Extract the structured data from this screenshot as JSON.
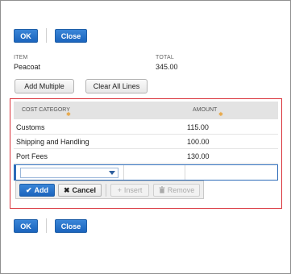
{
  "top_buttons": {
    "ok": "OK",
    "close": "Close"
  },
  "bottom_buttons": {
    "ok": "OK",
    "close": "Close"
  },
  "item": {
    "label": "ITEM",
    "value": "Peacoat"
  },
  "total": {
    "label": "TOTAL",
    "value": "345.00"
  },
  "toolbar": {
    "add_multiple": "Add Multiple",
    "clear_all_lines": "Clear All Lines"
  },
  "grid": {
    "headers": {
      "cost_category": "COST CATEGORY",
      "amount": "AMOUNT"
    },
    "required_marker": "✱",
    "rows": [
      {
        "category": "Customs",
        "amount": "115.00"
      },
      {
        "category": "Shipping and Handling",
        "amount": "100.00"
      },
      {
        "category": "Port Fees",
        "amount": "130.00"
      }
    ]
  },
  "edit_actions": {
    "add": "Add",
    "cancel": "Cancel",
    "insert": "Insert",
    "remove": "Remove"
  },
  "icons": {
    "add": "check-icon",
    "cancel": "x-icon",
    "insert": "plus-icon",
    "remove": "trash-icon",
    "dropdown": "chevron-down-icon"
  },
  "colors": {
    "primary": "#1b64bd",
    "highlight": "#d9323a",
    "required": "#e8a33c"
  }
}
